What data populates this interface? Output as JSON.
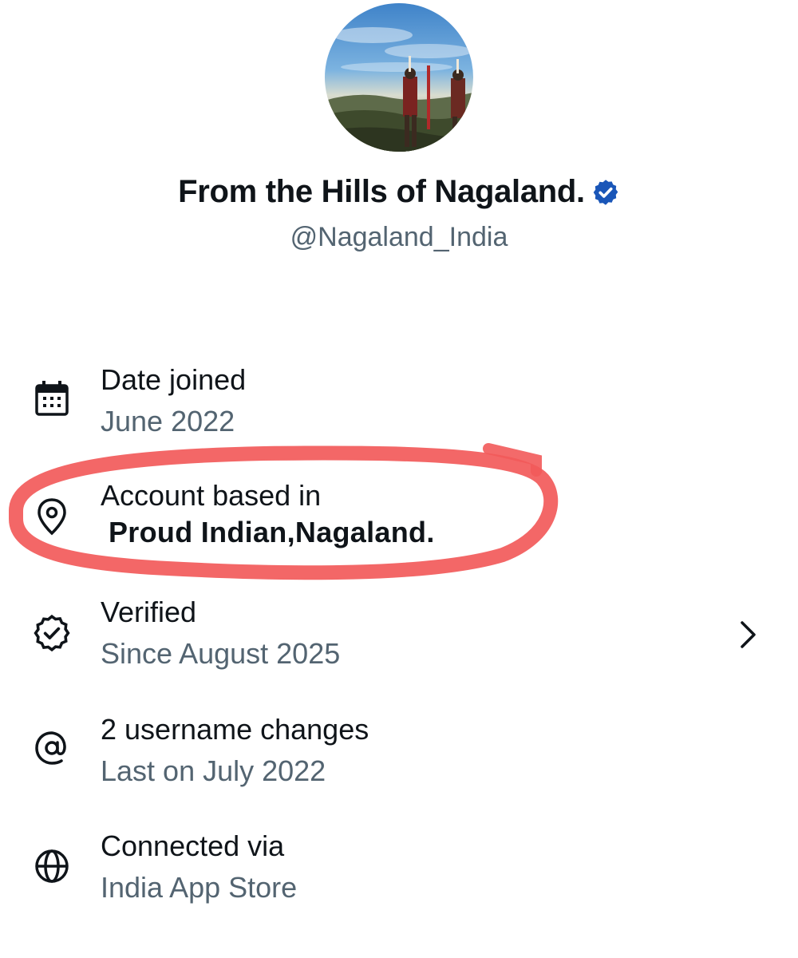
{
  "profile": {
    "display_name": "From the Hills of Nagaland.",
    "handle": "@Nagaland_India",
    "avatar_alt": "profile-avatar",
    "verified_icon": "verified-badge-icon",
    "brand_blue": "#1d9bf0",
    "badge_color": "#1a56b8"
  },
  "about": {
    "rows": [
      {
        "icon": "calendar-icon",
        "title": "Date joined",
        "value": "June 2022"
      },
      {
        "icon": "location-pin-icon",
        "title": "Account based in",
        "value": "Proud Indian,Nagaland."
      },
      {
        "icon": "verified-check-icon",
        "title": "Verified",
        "value": "Since August 2025",
        "chevron": "chevron-right-icon"
      },
      {
        "icon": "at-sign-icon",
        "title": "2 username changes",
        "value": "Last on July 2022"
      },
      {
        "icon": "globe-icon",
        "title": "Connected via",
        "value": "India App Store"
      }
    ]
  },
  "colors": {
    "primary_text": "#0f1419",
    "secondary_text": "#536471",
    "annotation_red": "#f25a5a"
  }
}
